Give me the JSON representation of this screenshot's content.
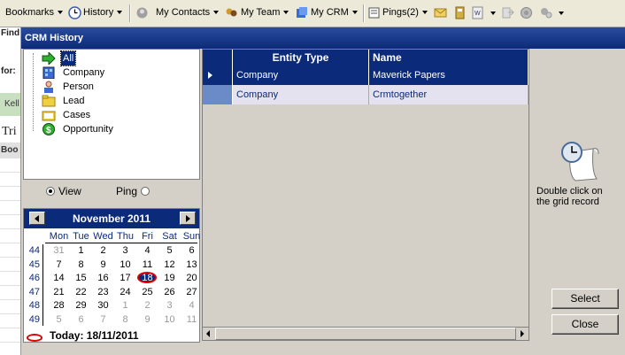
{
  "toolbar": {
    "bookmarks": "Bookmarks",
    "history": "History",
    "my_contacts": "My Contacts",
    "my_team": "My Team",
    "my_crm": "My CRM",
    "pings": "Pings(2)"
  },
  "background": {
    "find": "Find:",
    "for": "for:",
    "kel": "Kell",
    "tri": "Tri",
    "boo": "Boo"
  },
  "dialog": {
    "title": "CRM History",
    "tree": [
      "All",
      "Company",
      "Person",
      "Lead",
      "Cases",
      "Opportunity"
    ],
    "view_label": "View",
    "ping_label": "Ping",
    "view_selected": true,
    "calendar": {
      "month": "November 2011",
      "weekdays": [
        "Mon",
        "Tue",
        "Wed",
        "Thu",
        "Fri",
        "Sat",
        "Sun"
      ],
      "weeks": [
        {
          "wk": "44",
          "days": [
            "31",
            "1",
            "2",
            "3",
            "4",
            "5",
            "6"
          ]
        },
        {
          "wk": "45",
          "days": [
            "7",
            "8",
            "9",
            "10",
            "11",
            "12",
            "13"
          ]
        },
        {
          "wk": "46",
          "days": [
            "14",
            "15",
            "16",
            "17",
            "18",
            "19",
            "20"
          ]
        },
        {
          "wk": "47",
          "days": [
            "21",
            "22",
            "23",
            "24",
            "25",
            "26",
            "27"
          ]
        },
        {
          "wk": "48",
          "days": [
            "28",
            "29",
            "30",
            "1",
            "2",
            "3",
            "4"
          ]
        },
        {
          "wk": "49",
          "days": [
            "5",
            "6",
            "7",
            "8",
            "9",
            "10",
            "11"
          ]
        }
      ],
      "selected_day": "18",
      "today": "Today: 18/11/2011"
    },
    "grid": {
      "columns": [
        "Entity Type",
        "Name"
      ],
      "rows": [
        {
          "entity": "Company",
          "name": "Maverick Papers"
        },
        {
          "entity": "Company",
          "name": "Crmtogether"
        }
      ]
    },
    "hint": "Double click on the grid record",
    "select_button": "Select",
    "close_button": "Close"
  }
}
